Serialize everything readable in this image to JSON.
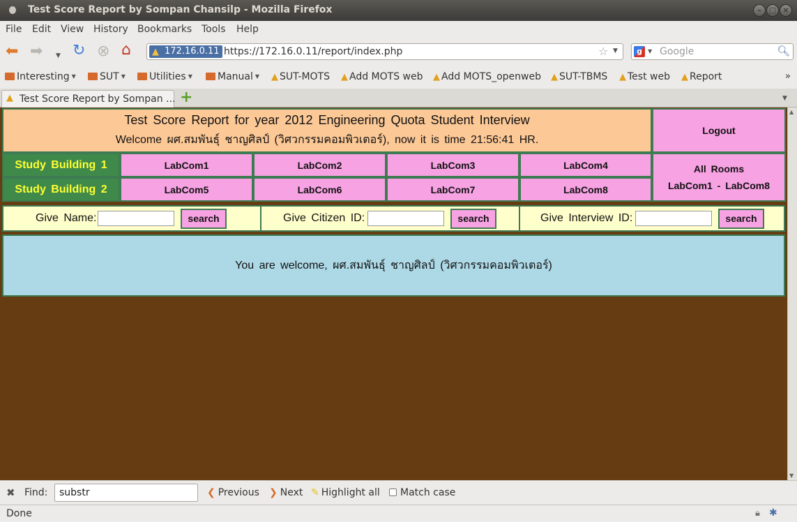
{
  "window": {
    "title": "Test Score Report by Sompan Chansilp - Mozilla Firefox"
  },
  "menu": [
    "File",
    "Edit",
    "View",
    "History",
    "Bookmarks",
    "Tools",
    "Help"
  ],
  "nav": {
    "site_identity": "172.16.0.11",
    "url": "https://172.16.0.11/report/index.php",
    "search_placeholder": "Google"
  },
  "bookmarks": {
    "folders": [
      "Interesting",
      "SUT",
      "Utilities",
      "Manual"
    ],
    "links": [
      "SUT-MOTS",
      "Add MOTS web",
      "Add MOTS_openweb",
      "SUT-TBMS",
      "Test web",
      "Report"
    ]
  },
  "tab": {
    "label": "Test Score Report by Sompan ..."
  },
  "page": {
    "header_title": "Test Score Report for year 2012 Engineering Quota Student Interview",
    "header_welcome": "Welcome ผศ.สมพันธุ์ ชาญศิลป์ (วิศวกรรมคอมพิวเตอร์), now it is time 21:56:41 HR.",
    "logout": "Logout",
    "buildings": [
      "Study Building 1",
      "Study Building 2"
    ],
    "labs_row1": [
      "LabCom1",
      "LabCom2",
      "LabCom3",
      "LabCom4"
    ],
    "labs_row2": [
      "LabCom5",
      "LabCom6",
      "LabCom7",
      "LabCom8"
    ],
    "all_rooms_line1": "All Rooms",
    "all_rooms_line2": "LabCom1 - LabCom8",
    "search_name_label": "Give Name:",
    "search_citizen_label": "Give Citizen ID:",
    "search_interview_label": "Give Interview ID:",
    "search_button": "search",
    "welcome_message": "You are welcome, ผศ.สมพันธุ์ ชาญศิลป์ (วิศวกรรมคอมพิวเตอร์)"
  },
  "findbar": {
    "label": "Find:",
    "value": "substr",
    "previous": "Previous",
    "next": "Next",
    "highlight": "Highlight all",
    "match_case": "Match case"
  },
  "status": {
    "text": "Done"
  }
}
